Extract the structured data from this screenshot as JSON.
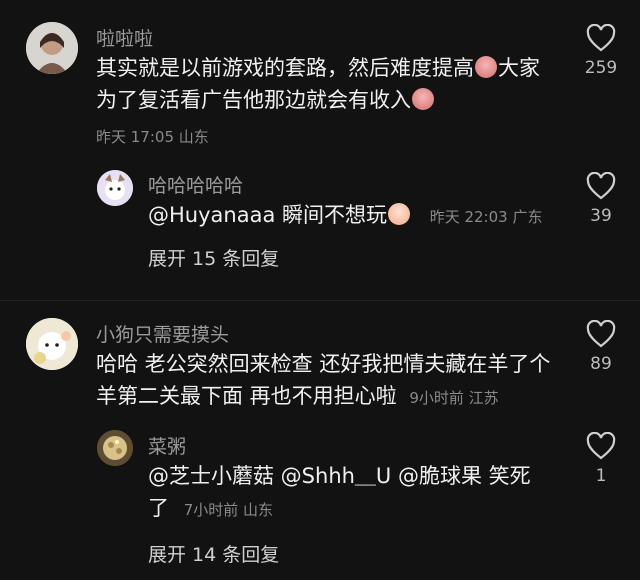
{
  "comments": [
    {
      "username": "啦啦啦",
      "line1": "其实就是以前游戏的套路，然后难度提高",
      "line1b": "大家",
      "line2": "为了复活看广告他那边就会有收入",
      "time": "昨天 17:05 山东",
      "likes": "259",
      "reply": {
        "username": "哈哈哈哈哈",
        "mention": "@Huyanaaa",
        "text": " 瞬间不想玩",
        "time": "昨天 22:03 广东",
        "likes": "39"
      },
      "expand": "展开 15 条回复"
    },
    {
      "username": "小狗只需要摸头",
      "line1": "哈哈 老公突然回来检查 还好我把情夫藏在羊了个",
      "line2": "羊第二关最下面 再也不用担心啦",
      "time": "9小时前 江苏",
      "likes": "89",
      "reply": {
        "username": "菜粥",
        "line1": "@芝士小蘑菇 @Shhh＿U @脆球果 笑死",
        "line2": "了",
        "time": "7小时前 山东",
        "likes": "1"
      },
      "expand": "展开 14 条回复"
    }
  ],
  "icons": {
    "like": "heart-outline-icon",
    "emoji_cry": "crying-face-emoji",
    "emoji_shy": "shy-face-emoji"
  },
  "colors": {
    "background": "#121212",
    "username": "#9a9a9a",
    "meta": "#8a8a8a"
  }
}
